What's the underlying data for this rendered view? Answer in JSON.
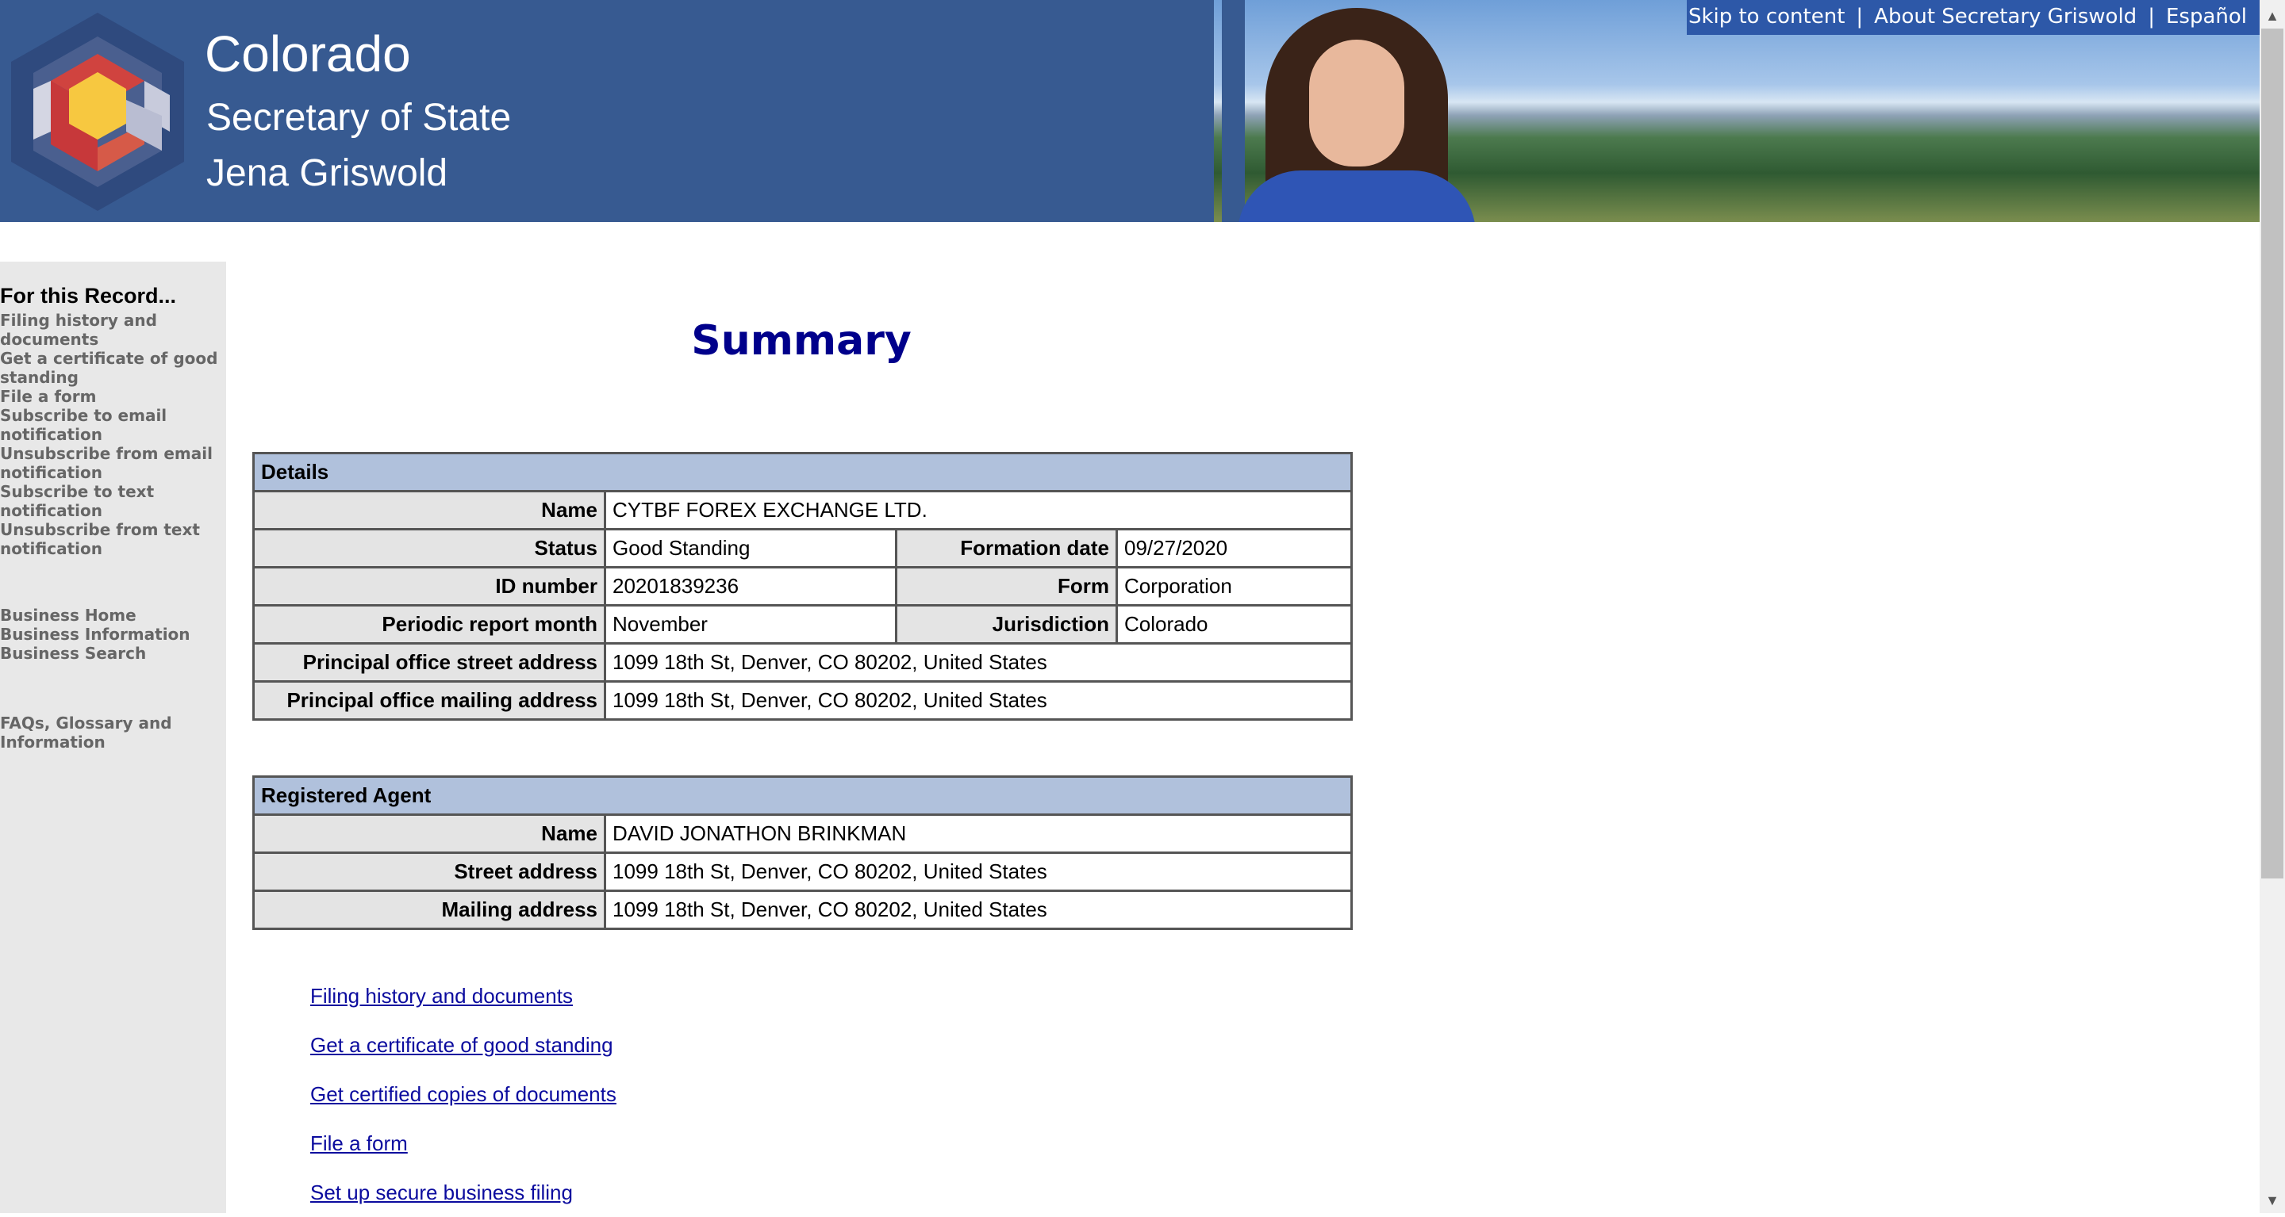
{
  "header": {
    "brand_line1": "Colorado",
    "brand_line2": "Secretary of State",
    "brand_line3": "Jena Griswold",
    "logo_icon": "colorado-c-hexagon-logo",
    "topnav": {
      "skip": "Skip to content",
      "sep": "|",
      "about": "About Secretary Griswold",
      "espanol": "Español"
    }
  },
  "sidebar": {
    "heading": "For this Record...",
    "record_links": [
      "Filing history and documents",
      "Get a certificate of good standing",
      "File a form",
      "Subscribe to email notification",
      "Unsubscribe from email notification",
      "Subscribe to text notification",
      "Unsubscribe from text notification"
    ],
    "business_links": [
      "Business Home",
      "Business Information",
      "Business Search"
    ],
    "info_links": [
      "FAQs, Glossary and Information"
    ]
  },
  "main": {
    "title": "Summary",
    "details": {
      "heading": "Details",
      "name_label": "Name",
      "name": "CYTBF FOREX EXCHANGE LTD.",
      "status_label": "Status",
      "status": "Good Standing",
      "formation_date_label": "Formation date",
      "formation_date": "09/27/2020",
      "id_label": "ID number",
      "id": "20201839236",
      "form_label": "Form",
      "form": "Corporation",
      "report_month_label": "Periodic report month",
      "report_month": "November",
      "jurisdiction_label": "Jurisdiction",
      "jurisdiction": "Colorado",
      "street_label": "Principal office street address",
      "street": "1099 18th St, Denver, CO 80202, United States",
      "mailing_label": "Principal office mailing address",
      "mailing": "1099 18th St, Denver, CO 80202, United States"
    },
    "agent": {
      "heading": "Registered Agent",
      "name_label": "Name",
      "name": "DAVID JONATHON BRINKMAN",
      "street_label": "Street address",
      "street": "1099 18th St, Denver, CO 80202, United States",
      "mailing_label": "Mailing address",
      "mailing": "1099 18th St, Denver, CO 80202, United States"
    },
    "action_links": [
      "Filing history and documents",
      "Get a certificate of good standing",
      "Get certified copies of documents",
      "File a form",
      "Set up secure business filing"
    ]
  },
  "colors": {
    "header_bg": "#375a91",
    "topnav_bg": "#2d58a8",
    "title": "#00008b",
    "table_head": "#b0c1dc",
    "label_cell": "#e4e4e4",
    "link": "#0b0b9e",
    "sidebar_link": "#666666"
  }
}
